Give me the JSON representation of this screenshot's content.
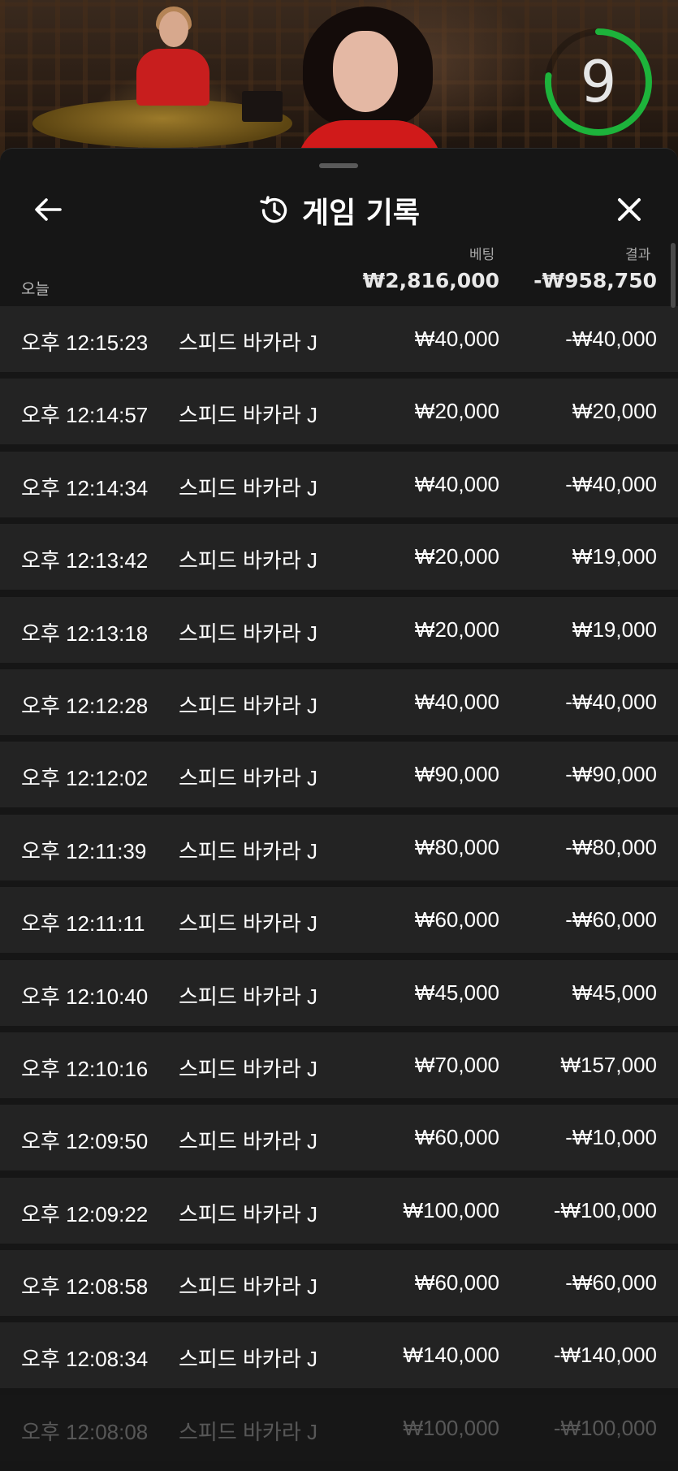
{
  "video": {
    "countdown": "9",
    "timer_color": "#1db33b"
  },
  "header": {
    "title": "게임 기록",
    "back_icon": "arrow-left-icon",
    "history_icon": "history-clock-icon",
    "close_icon": "close-icon"
  },
  "columns": {
    "bet": "베팅",
    "result": "결과"
  },
  "summary": {
    "label": "오늘",
    "total_bet": "₩2,816,000",
    "total_result": "-₩958,750"
  },
  "rows": [
    {
      "time": "오후 12:15:23",
      "game": "스피드 바카라 J",
      "bet": "₩40,000",
      "result": "-₩40,000"
    },
    {
      "time": "오후 12:14:57",
      "game": "스피드 바카라 J",
      "bet": "₩20,000",
      "result": "₩20,000"
    },
    {
      "time": "오후 12:14:34",
      "game": "스피드 바카라 J",
      "bet": "₩40,000",
      "result": "-₩40,000"
    },
    {
      "time": "오후 12:13:42",
      "game": "스피드 바카라 J",
      "bet": "₩20,000",
      "result": "₩19,000"
    },
    {
      "time": "오후 12:13:18",
      "game": "스피드 바카라 J",
      "bet": "₩20,000",
      "result": "₩19,000"
    },
    {
      "time": "오후 12:12:28",
      "game": "스피드 바카라 J",
      "bet": "₩40,000",
      "result": "-₩40,000"
    },
    {
      "time": "오후 12:12:02",
      "game": "스피드 바카라 J",
      "bet": "₩90,000",
      "result": "-₩90,000"
    },
    {
      "time": "오후 12:11:39",
      "game": "스피드 바카라 J",
      "bet": "₩80,000",
      "result": "-₩80,000"
    },
    {
      "time": "오후 12:11:11",
      "game": "스피드 바카라 J",
      "bet": "₩60,000",
      "result": "-₩60,000"
    },
    {
      "time": "오후 12:10:40",
      "game": "스피드 바카라 J",
      "bet": "₩45,000",
      "result": "₩45,000"
    },
    {
      "time": "오후 12:10:16",
      "game": "스피드 바카라 J",
      "bet": "₩70,000",
      "result": "₩157,000"
    },
    {
      "time": "오후 12:09:50",
      "game": "스피드 바카라 J",
      "bet": "₩60,000",
      "result": "-₩10,000"
    },
    {
      "time": "오후 12:09:22",
      "game": "스피드 바카라 J",
      "bet": "₩100,000",
      "result": "-₩100,000"
    },
    {
      "time": "오후 12:08:58",
      "game": "스피드 바카라 J",
      "bet": "₩60,000",
      "result": "-₩60,000"
    },
    {
      "time": "오후 12:08:34",
      "game": "스피드 바카라 J",
      "bet": "₩140,000",
      "result": "-₩140,000"
    },
    {
      "time": "오후 12:08:08",
      "game": "스피드 바카라 J",
      "bet": "₩100,000",
      "result": "-₩100,000"
    }
  ]
}
